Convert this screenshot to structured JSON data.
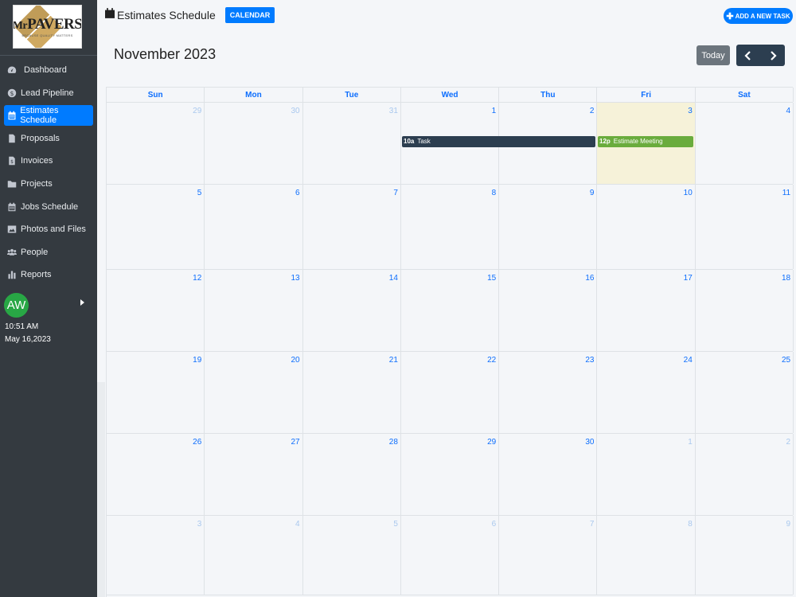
{
  "sidebar": {
    "logo": {
      "main": "PAVERS",
      "prefix": "Mr",
      "tagline": "BECAUSE QUALITY MATTERS"
    },
    "items": [
      {
        "label": "Dashboard",
        "icon": "tachometer-icon"
      },
      {
        "label": "Lead Pipeline",
        "icon": "dollar-circle-icon"
      },
      {
        "label": "Estimates Schedule",
        "icon": "calendar-icon"
      },
      {
        "label": "Proposals",
        "icon": "file-icon"
      },
      {
        "label": "Invoices",
        "icon": "invoice-icon"
      },
      {
        "label": "Projects",
        "icon": "folder-icon"
      },
      {
        "label": "Jobs Schedule",
        "icon": "calendar-icon"
      },
      {
        "label": "Photos and Files",
        "icon": "image-icon"
      },
      {
        "label": "People",
        "icon": "users-icon"
      },
      {
        "label": "Reports",
        "icon": "bar-chart-icon"
      }
    ],
    "active_index": 2,
    "user": {
      "initials": "AW",
      "avatar_color": "#28a745"
    },
    "time": "10:51 AM",
    "date": "May 16,2023"
  },
  "header": {
    "title": "Estimates Schedule",
    "calendar_button": "CALENDAR",
    "add_task_button": "ADD A NEW TASK"
  },
  "calendar": {
    "month_label": "November 2023",
    "today_button": "Today",
    "weekdays": [
      "Sun",
      "Mon",
      "Tue",
      "Wed",
      "Thu",
      "Fri",
      "Sat"
    ],
    "weeks": [
      {
        "days": [
          {
            "n": "29",
            "muted": true
          },
          {
            "n": "30",
            "muted": true
          },
          {
            "n": "31",
            "muted": true
          },
          {
            "n": "1"
          },
          {
            "n": "2"
          },
          {
            "n": "3",
            "today": true
          },
          {
            "n": "4"
          }
        ]
      },
      {
        "days": [
          {
            "n": "5"
          },
          {
            "n": "6"
          },
          {
            "n": "7"
          },
          {
            "n": "8"
          },
          {
            "n": "9"
          },
          {
            "n": "10"
          },
          {
            "n": "11"
          }
        ]
      },
      {
        "days": [
          {
            "n": "12"
          },
          {
            "n": "13"
          },
          {
            "n": "14"
          },
          {
            "n": "15"
          },
          {
            "n": "16"
          },
          {
            "n": "17"
          },
          {
            "n": "18"
          }
        ]
      },
      {
        "days": [
          {
            "n": "19"
          },
          {
            "n": "20"
          },
          {
            "n": "21"
          },
          {
            "n": "22"
          },
          {
            "n": "23"
          },
          {
            "n": "24"
          },
          {
            "n": "25"
          }
        ]
      },
      {
        "days": [
          {
            "n": "26"
          },
          {
            "n": "27"
          },
          {
            "n": "28"
          },
          {
            "n": "29"
          },
          {
            "n": "30"
          },
          {
            "n": "1",
            "muted": true
          },
          {
            "n": "2",
            "muted": true
          }
        ]
      },
      {
        "days": [
          {
            "n": "3",
            "muted": true
          },
          {
            "n": "4",
            "muted": true
          },
          {
            "n": "5",
            "muted": true
          },
          {
            "n": "6",
            "muted": true
          },
          {
            "n": "7",
            "muted": true
          },
          {
            "n": "8",
            "muted": true
          },
          {
            "n": "9",
            "muted": true
          }
        ]
      }
    ],
    "events": [
      {
        "time": "10a",
        "title": "Task",
        "color": "#2c3e50"
      },
      {
        "time": "12p",
        "title": "Estimate Meeting",
        "color": "#6aac3d"
      }
    ],
    "colors": {
      "accent": "#007bff",
      "today_bg": "#f6f2d9",
      "sidebar": "#343a40"
    }
  }
}
